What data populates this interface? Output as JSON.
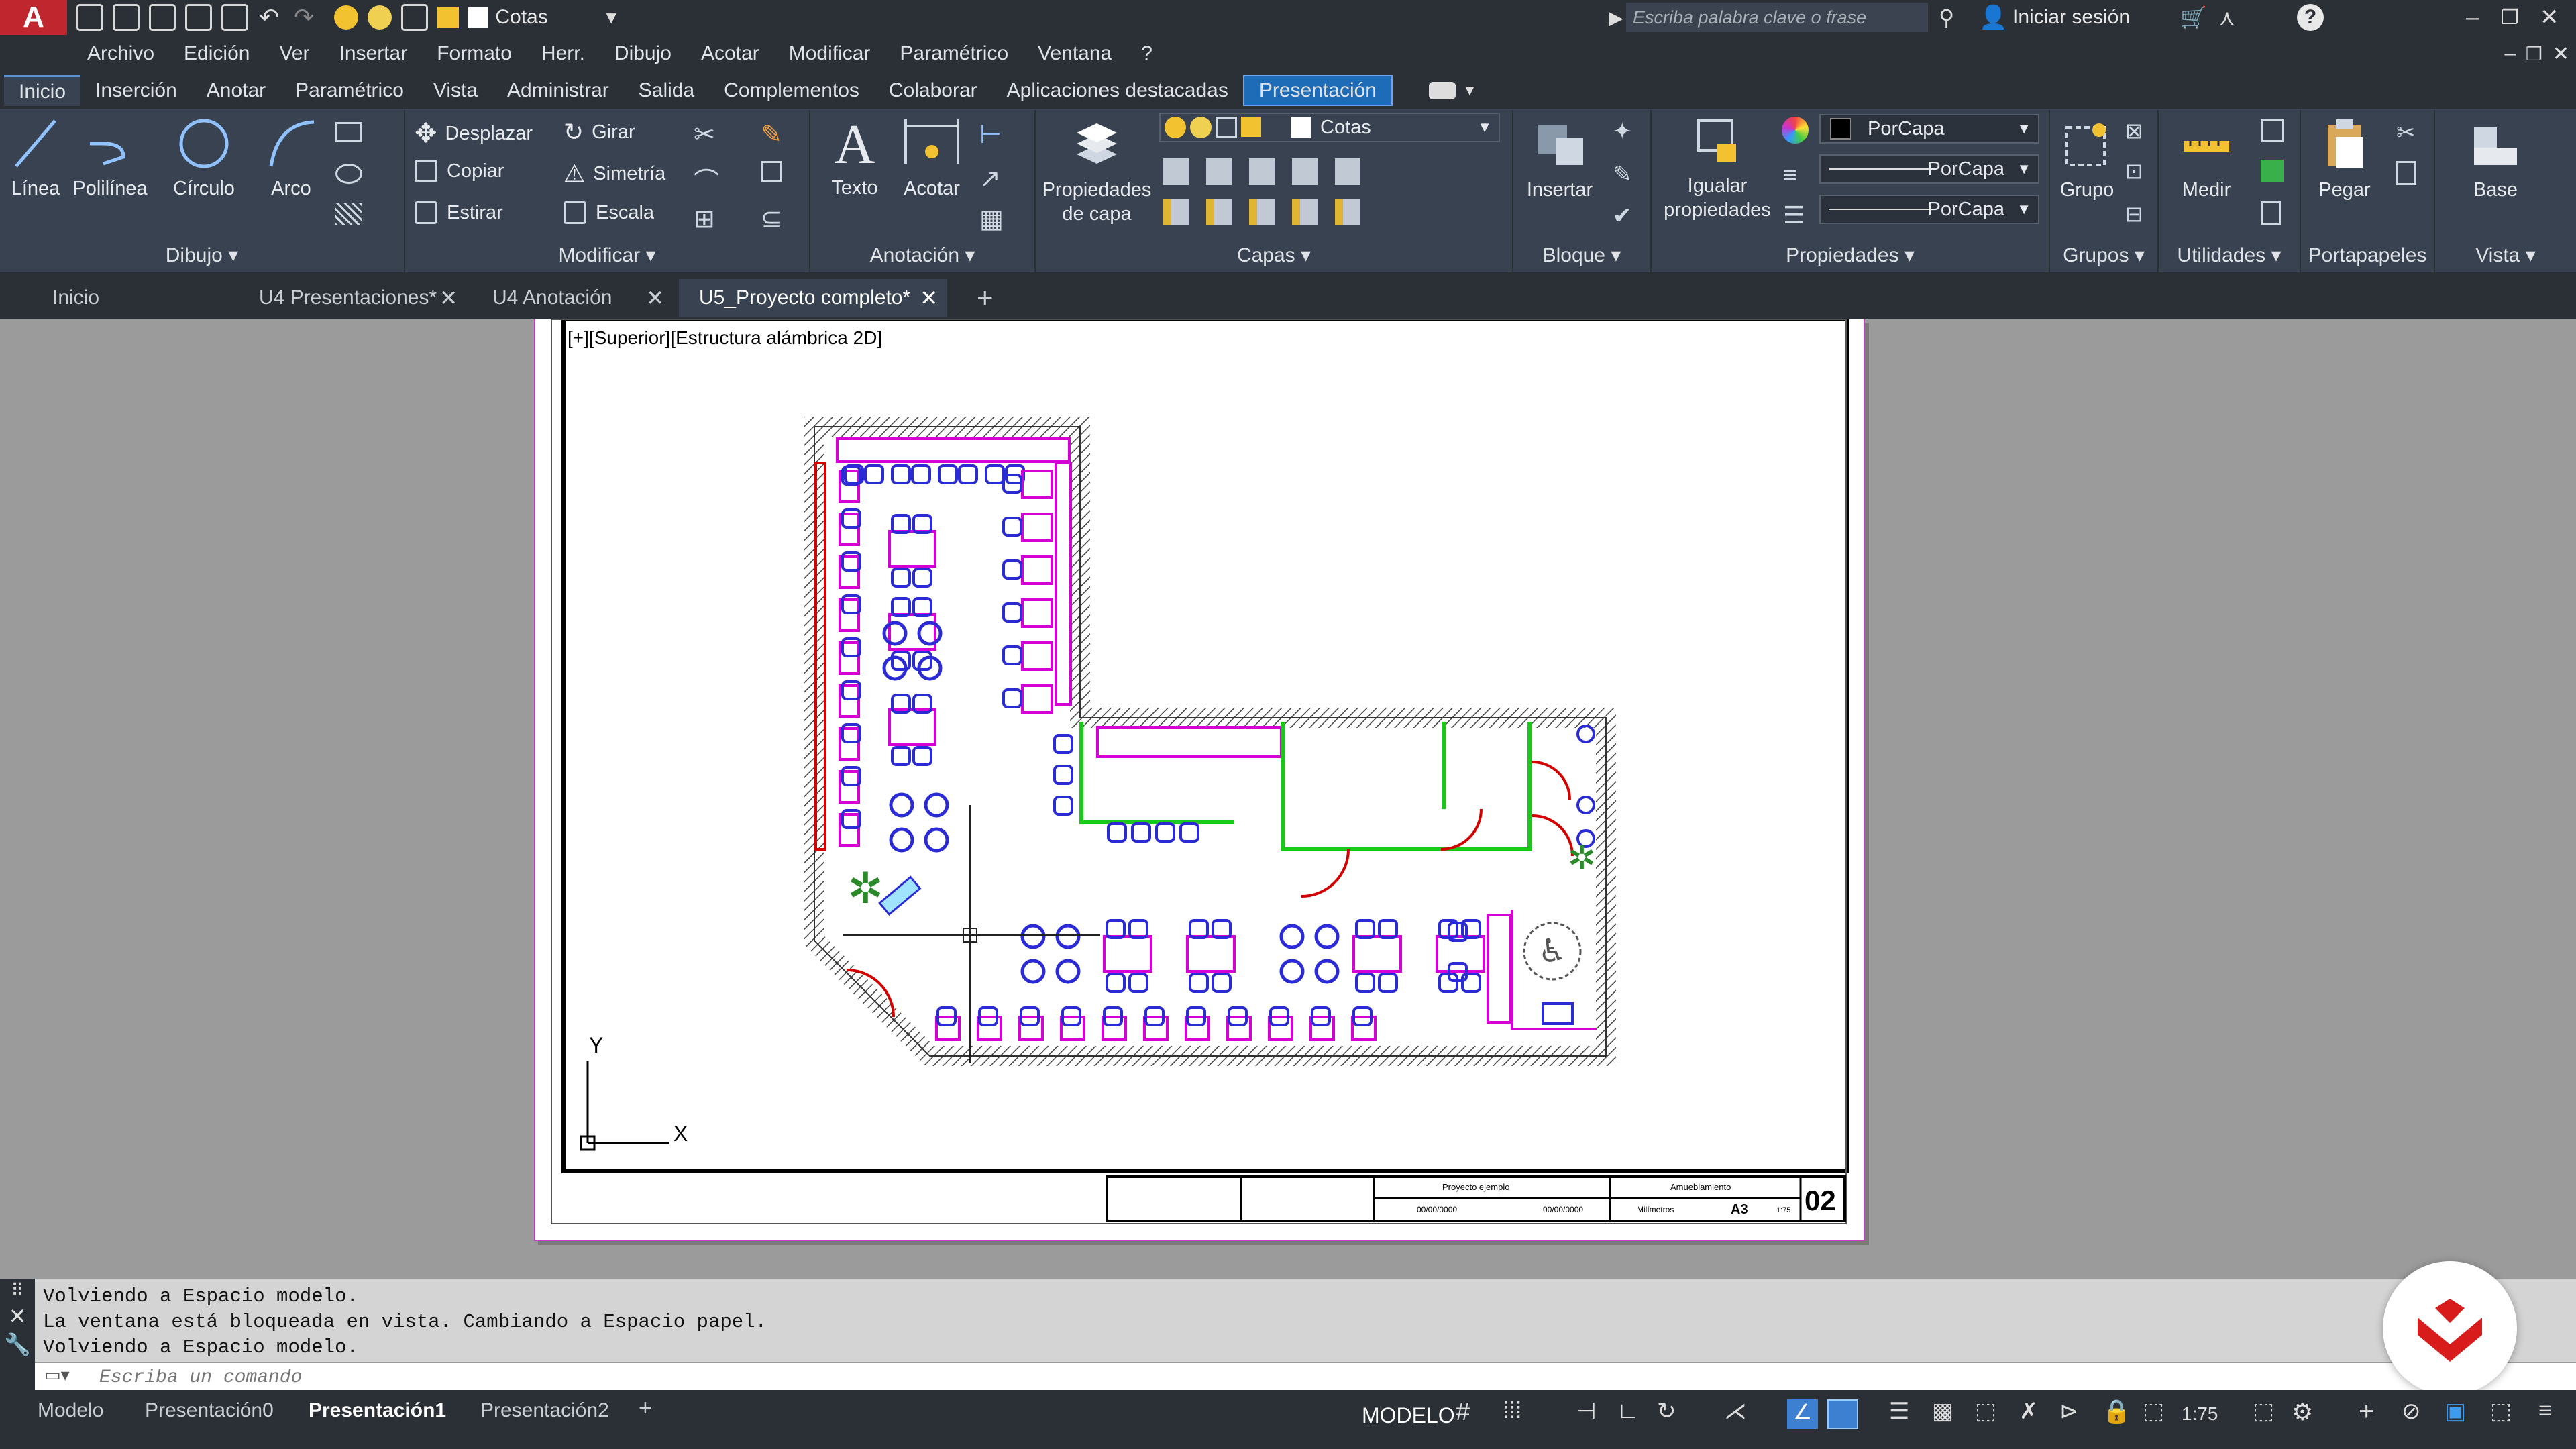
{
  "app": {
    "logo": "A",
    "layer_combo": "Cotas",
    "search_placeholder": "Escriba palabra clave o frase",
    "signin": "Iniciar sesión"
  },
  "menu": [
    "Archivo",
    "Edición",
    "Ver",
    "Insertar",
    "Formato",
    "Herr.",
    "Dibujo",
    "Acotar",
    "Modificar",
    "Paramétrico",
    "Ventana",
    "?"
  ],
  "ribbon_tabs": [
    "Inicio",
    "Inserción",
    "Anotar",
    "Paramétrico",
    "Vista",
    "Administrar",
    "Salida",
    "Complementos",
    "Colaborar",
    "Aplicaciones destacadas",
    "Presentación"
  ],
  "dibujo": {
    "title": "Dibujo",
    "linea": "Línea",
    "polilinea": "Polilínea",
    "circulo": "Círculo",
    "arco": "Arco"
  },
  "modificar": {
    "title": "Modificar",
    "desplazar": "Desplazar",
    "girar": "Girar",
    "copiar": "Copiar",
    "simetria": "Simetría",
    "estirar": "Estirar",
    "escala": "Escala"
  },
  "anotacion": {
    "title": "Anotación",
    "texto": "Texto",
    "acotar": "Acotar"
  },
  "capas": {
    "title": "Capas",
    "propiedades": "Propiedades",
    "propiedades2": "de capa",
    "combo": "Cotas"
  },
  "bloque": {
    "title": "Bloque",
    "insertar": "Insertar"
  },
  "propiedades": {
    "title": "Propiedades",
    "igualar": "Igualar",
    "igualar2": "propiedades",
    "color": "PorCapa",
    "linetype": "PorCapa",
    "lineweight": "PorCapa"
  },
  "grupos": {
    "title": "Grupos",
    "grupo": "Grupo"
  },
  "utilidades": {
    "title": "Utilidades",
    "medir": "Medir"
  },
  "portapapeles": {
    "title": "Portapapeles",
    "pegar": "Pegar"
  },
  "vista": {
    "title": "Vista",
    "base": "Base"
  },
  "file_tabs": [
    "Inicio",
    "U4 Presentaciones*",
    "U4 Anotación",
    "U5_Proyecto completo*"
  ],
  "viewport_label": "[+][Superior][Estructura alámbrica 2D]",
  "ucs": {
    "x": "X",
    "y": "Y"
  },
  "title_block": {
    "project": "Proyecto ejemplo",
    "sheet": "Amueblamiento",
    "date1": "00/00/0000",
    "date2": "00/00/0000",
    "units": "Milímetros",
    "format": "A3",
    "scale": "1:75",
    "number": "02"
  },
  "command_history": [
    "Volviendo a Espacio modelo.",
    "La ventana está bloqueada en vista. Cambiando a Espacio papel.",
    "Volviendo a Espacio modelo."
  ],
  "command_placeholder": "Escriba un comando",
  "layout_tabs": [
    "Modelo",
    "Presentación0",
    "Presentación1",
    "Presentación2"
  ],
  "status": {
    "mode": "MODELO",
    "scale": "1:75"
  },
  "colors": {
    "wall": "#6b6b6b",
    "furniture": "#2b2bd6",
    "partition": "#d400d4",
    "door": "#d40000",
    "glass": "#19c819"
  }
}
